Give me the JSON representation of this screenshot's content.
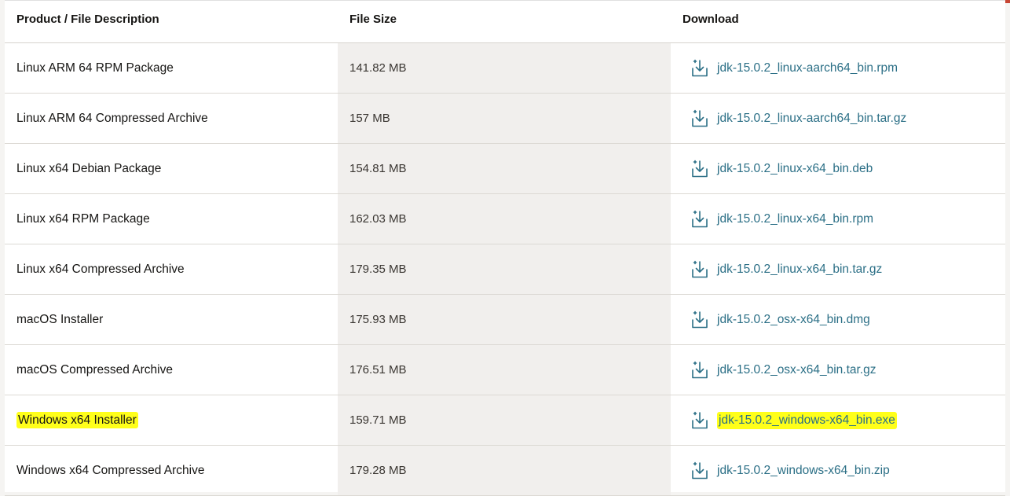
{
  "header": {
    "col_description": "Product / File Description",
    "col_size": "File Size",
    "col_download": "Download"
  },
  "rows": [
    {
      "description": "Linux ARM 64 RPM Package",
      "size": "141.82 MB",
      "file": "jdk-15.0.2_linux-aarch64_bin.rpm"
    },
    {
      "description": "Linux ARM 64 Compressed Archive",
      "size": "157 MB",
      "file": "jdk-15.0.2_linux-aarch64_bin.tar.gz"
    },
    {
      "description": "Linux x64 Debian Package",
      "size": "154.81 MB",
      "file": "jdk-15.0.2_linux-x64_bin.deb"
    },
    {
      "description": "Linux x64 RPM Package",
      "size": "162.03 MB",
      "file": "jdk-15.0.2_linux-x64_bin.rpm"
    },
    {
      "description": "Linux x64 Compressed Archive",
      "size": "179.35 MB",
      "file": "jdk-15.0.2_linux-x64_bin.tar.gz"
    },
    {
      "description": "macOS Installer",
      "size": "175.93 MB",
      "file": "jdk-15.0.2_osx-x64_bin.dmg"
    },
    {
      "description": "macOS Compressed Archive",
      "size": "176.51 MB",
      "file": "jdk-15.0.2_osx-x64_bin.tar.gz"
    },
    {
      "description": "Windows x64 Installer",
      "size": "159.71 MB",
      "file": "jdk-15.0.2_windows-x64_bin.exe"
    },
    {
      "description": "Windows x64 Compressed Archive",
      "size": "179.28 MB",
      "file": "jdk-15.0.2_windows-x64_bin.zip"
    }
  ],
  "colors": {
    "link": "#2b6f86",
    "highlight": "#ffff1a",
    "size_column_bg": "#f1efed"
  },
  "icons": {
    "download": "download-icon"
  }
}
